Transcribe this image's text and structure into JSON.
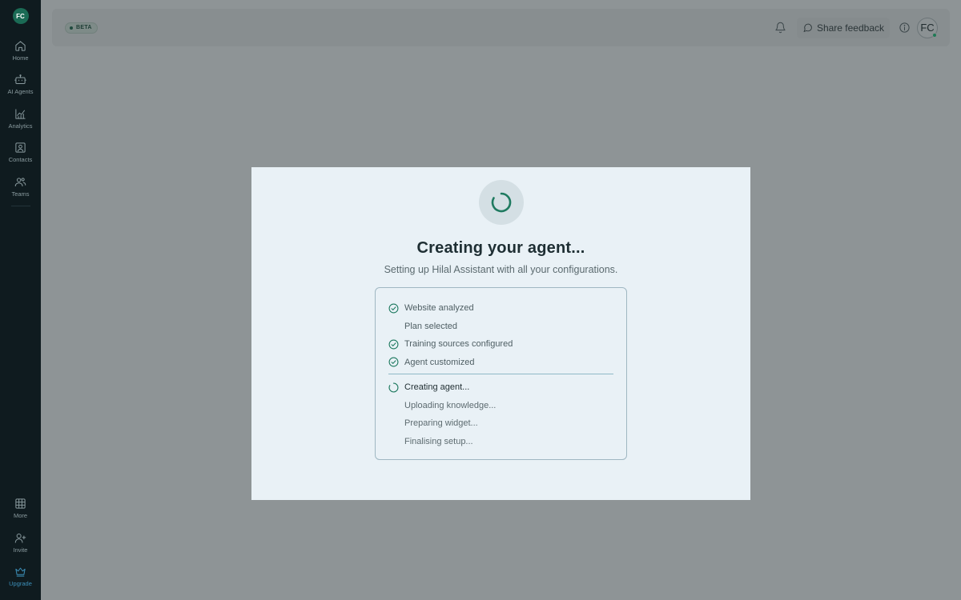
{
  "sidebar": {
    "org_initials": "FC",
    "items": [
      {
        "label": "Home",
        "icon": "home-icon"
      },
      {
        "label": "AI Agents",
        "icon": "robot-icon"
      },
      {
        "label": "Analytics",
        "icon": "chart-line-icon"
      },
      {
        "label": "Contacts",
        "icon": "contact-icon"
      },
      {
        "label": "Teams",
        "icon": "users-icon"
      }
    ],
    "bottom_items": [
      {
        "label": "More",
        "icon": "grid-icon"
      },
      {
        "label": "Invite",
        "icon": "user-plus-icon"
      },
      {
        "label": "Upgrade",
        "icon": "crown-icon"
      }
    ]
  },
  "topbar": {
    "badge": "BETA",
    "feedback_label": "Share feedback",
    "avatar_initials": "FC"
  },
  "modal": {
    "title": "Creating your agent...",
    "subtitle": "Setting up Hilal Assistant with all your configurations.",
    "completed_steps": [
      {
        "label": "Website analyzed",
        "status": "done"
      },
      {
        "label": "Plan selected",
        "status": "none"
      },
      {
        "label": "Training sources configured",
        "status": "done"
      },
      {
        "label": "Agent customized",
        "status": "done"
      }
    ],
    "progress_steps": [
      {
        "label": "Creating agent...",
        "status": "in-progress"
      },
      {
        "label": "Uploading knowledge...",
        "status": "pending"
      },
      {
        "label": "Preparing widget...",
        "status": "pending"
      },
      {
        "label": "Finalising setup...",
        "status": "pending"
      }
    ]
  },
  "colors": {
    "accent": "#1b6b55",
    "sidebar_bg": "#0f1b1f",
    "overlay": "#8e9496",
    "modal_bg": "#e9f1f6",
    "upgrade": "#3c8fb8"
  }
}
